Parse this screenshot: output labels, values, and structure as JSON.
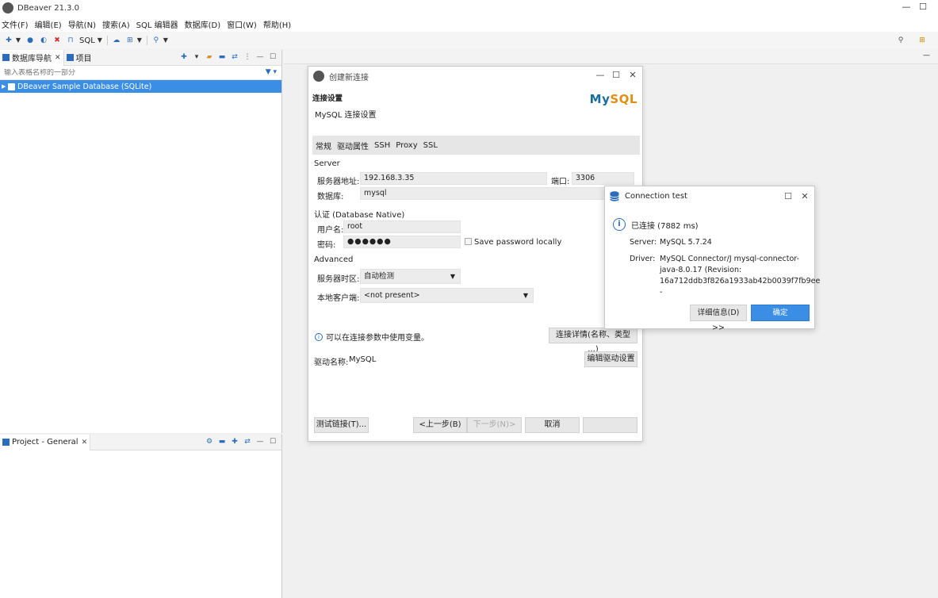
{
  "app": {
    "title": "DBeaver 21.3.0",
    "window_controls": {
      "minimize": "—",
      "maximize": "☐"
    }
  },
  "menu": [
    "文件(F)",
    "编辑(E)",
    "导航(N)",
    "搜索(A)",
    "SQL 编辑器",
    "数据库(D)",
    "窗口(W)",
    "帮助(H)"
  ],
  "toolbar": {
    "sql_label": "SQL"
  },
  "nav_panel": {
    "tabs": [
      "数据库导航",
      "项目"
    ],
    "close": "✕",
    "filter_placeholder": "输入表格名称的一部分",
    "tree": [
      {
        "label": "DBeaver Sample Database (SQLite)"
      }
    ]
  },
  "project_panel": {
    "tab": "Project - General",
    "close": "✕"
  },
  "dialog": {
    "title": "创建新连接",
    "header_title": "连接设置",
    "header_subtitle": "MySQL 连接设置",
    "logo": {
      "my": "My",
      "sql": "SQL"
    },
    "tabs": [
      "常规",
      "驱动属性",
      "SSH",
      "Proxy",
      "SSL"
    ],
    "server_section": "Server",
    "host_label": "服务器地址:",
    "host_value": "192.168.3.35",
    "port_label": "端口:",
    "port_value": "3306",
    "db_label": "数据库:",
    "db_value": "mysql",
    "auth_section": "认证 (Database Native)",
    "user_label": "用户名:",
    "user_value": "root",
    "pass_label": "密码:",
    "pass_value": "●●●●●●",
    "save_pass_label": "Save password locally",
    "advanced_section": "Advanced",
    "tz_label": "服务器时区:",
    "tz_value": "自动检测",
    "client_label": "本地客户端:",
    "client_value": "<not present>",
    "vars_hint": "可以在连接参数中使用变量。",
    "conn_details_button": "连接详情(名称、类型 ...)",
    "driver_label": "驱动名称:",
    "driver_value": "MySQL",
    "edit_driver_button": "编辑驱动设置",
    "test_button": "测试链接(T)...",
    "back_button": "<上一步(B)",
    "next_button": "下一步(N)>",
    "cancel_button": "取消",
    "finish_button": ""
  },
  "popup": {
    "title": "Connection test",
    "status": "已连接 (7882 ms)",
    "server_label": "Server:",
    "server_value": "MySQL 5.7.24",
    "driver_label": "Driver:",
    "driver_value": "MySQL Connector/J mysql-connector-java-8.0.17 (Revision: 16a712ddb3f826a1933ab42b0039f7fb9ee -",
    "details_button": "详细信息(D) >>",
    "ok_button": "确定",
    "accent_color": "#3a8ee6"
  }
}
